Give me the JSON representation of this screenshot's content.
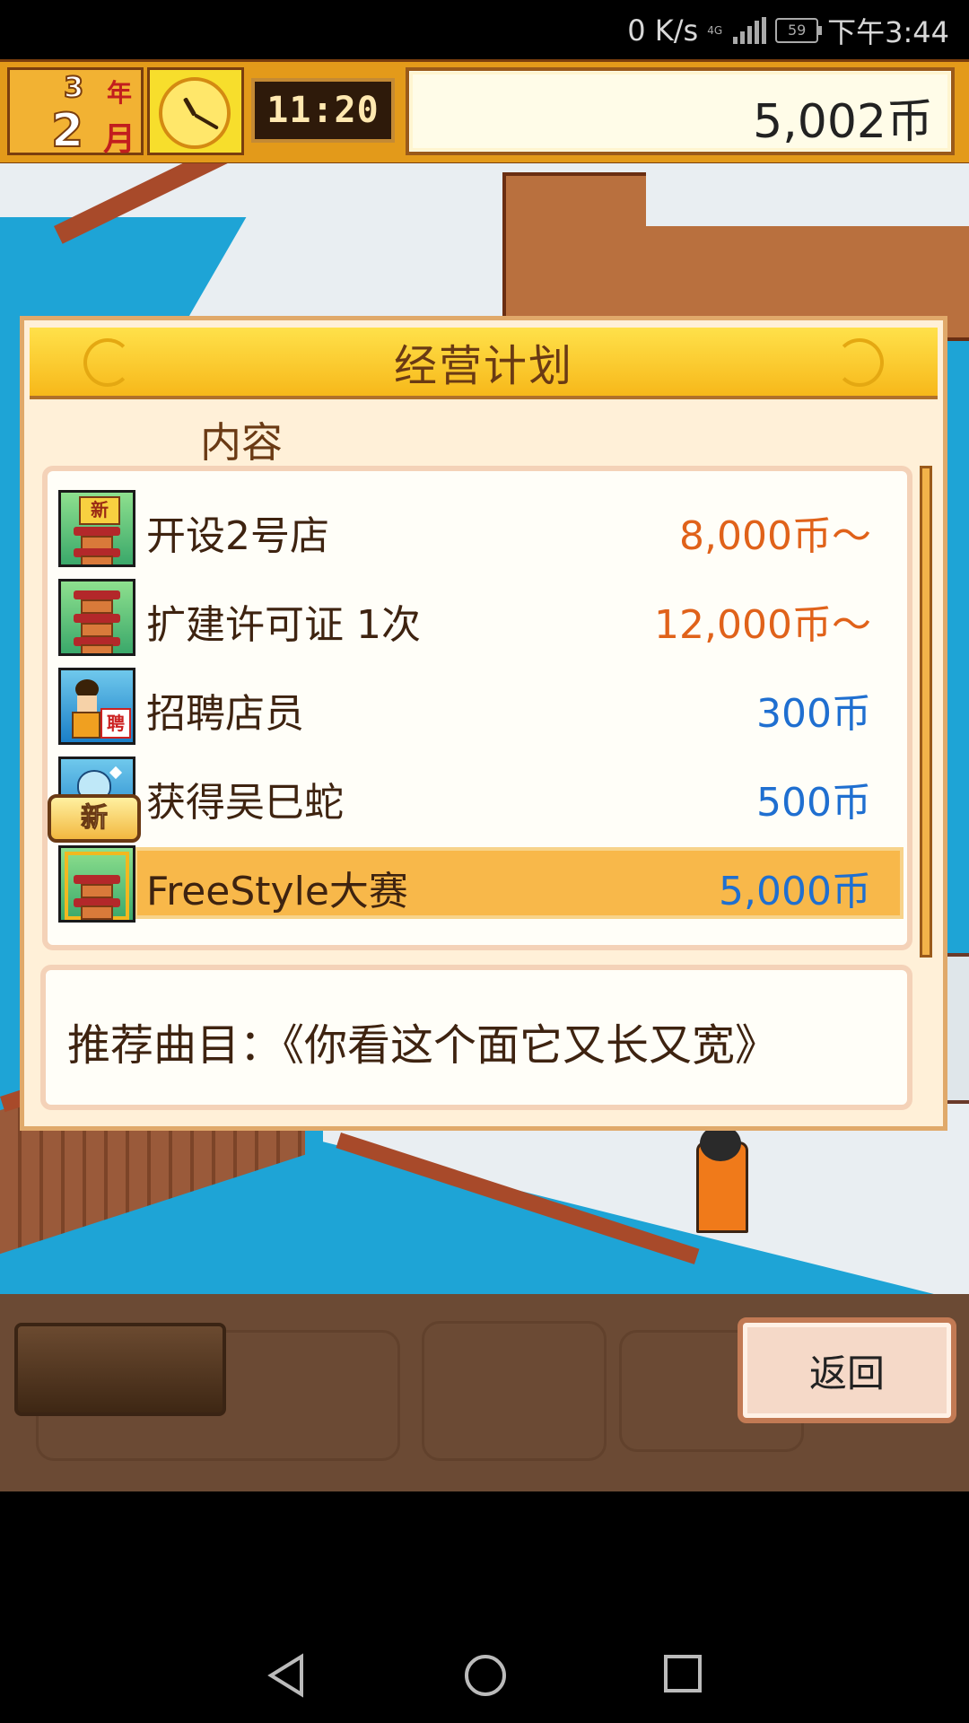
{
  "status_bar": {
    "net_speed": "0 K/s",
    "network_type": "4G",
    "battery_level": "59",
    "time": "下午3:44"
  },
  "hud": {
    "year": "3",
    "year_unit": "年",
    "month": "2",
    "month_unit": "月",
    "clock_time": "11:20",
    "money": "5,002币"
  },
  "dialog": {
    "title": "经营计划",
    "column_label": "内容",
    "new_badge": "新",
    "items": [
      {
        "label": "开设2号店",
        "price": "8,000币～",
        "price_color": "#e0621a",
        "icon": "new-shop-pagoda-icon",
        "icon_tag": "新",
        "selected": false
      },
      {
        "label": "扩建许可证 1次",
        "price": "12,000币～",
        "price_color": "#e0621a",
        "icon": "expand-pagoda-icon",
        "selected": false
      },
      {
        "label": "招聘店员",
        "price": "300币",
        "price_color": "#1f6fd0",
        "icon": "hire-staff-icon",
        "icon_tag": "聘",
        "selected": false
      },
      {
        "label": "获得吴巳蛇",
        "price": "500币",
        "price_color": "#1f6fd0",
        "icon": "snake-creature-icon",
        "selected": false
      },
      {
        "label": "FreeStyle大赛",
        "price": "5,000币",
        "price_color": "#1f6fd0",
        "icon": "contest-pagoda-icon",
        "selected": true
      }
    ],
    "description": "推荐曲目：《你看这个面它又长又宽》"
  },
  "bottom_bar": {
    "back_label": "返回"
  },
  "colors": {
    "accent": "#f7b81a",
    "selected_row": "#f8b84a",
    "text_brown": "#3e2310"
  }
}
